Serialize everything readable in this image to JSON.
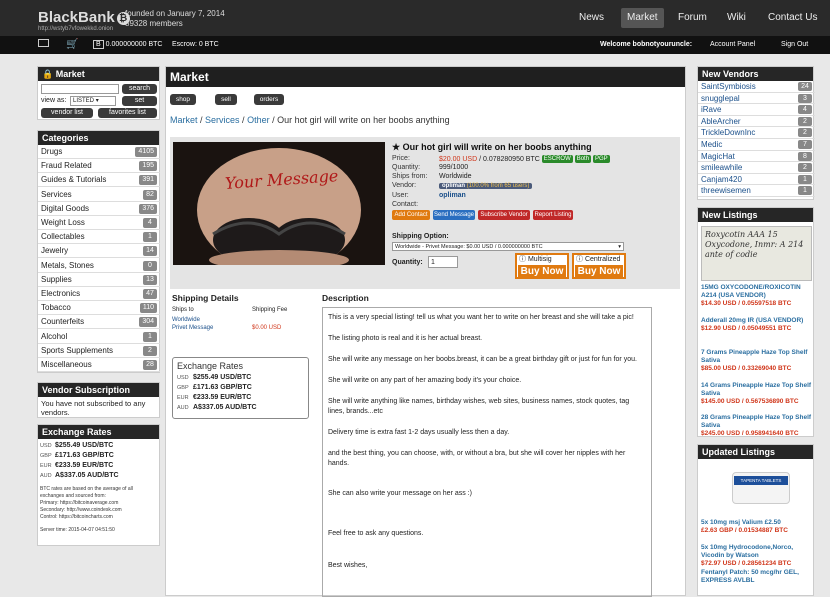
{
  "header": {
    "logo": "BlackBank",
    "logo_url": "http://wstyb7vfowekkd.onion",
    "founded": "founded on January 7, 2014",
    "members": "89328 members",
    "nav": [
      "News",
      "Market",
      "Forum",
      "Wiki",
      "Contact Us"
    ],
    "active_nav": "Market"
  },
  "subbar": {
    "balance": "0.000000000 BTC",
    "escrow": "Escrow: 0 BTC",
    "welcome": "Welcome bobnotyouruncle:",
    "account": "Account Panel",
    "signout": "Sign Out"
  },
  "market_box": {
    "title": "Market",
    "search_btn": "search",
    "view_as": "view as:",
    "view_value": "LISTED",
    "set_btn": "set",
    "vendor_list": "vendor list",
    "favorites": "favorites list"
  },
  "categories": {
    "title": "Categories",
    "items": [
      {
        "name": "Drugs",
        "count": "4105"
      },
      {
        "name": "Fraud Related",
        "count": "195"
      },
      {
        "name": "Guides & Tutorials",
        "count": "391"
      },
      {
        "name": "Services",
        "count": "82"
      },
      {
        "name": "Digital Goods",
        "count": "376"
      },
      {
        "name": "Weight Loss",
        "count": "4"
      },
      {
        "name": "Collectables",
        "count": "1"
      },
      {
        "name": "Jewelry",
        "count": "14"
      },
      {
        "name": "Metals, Stones",
        "count": "0"
      },
      {
        "name": "Supplies",
        "count": "13"
      },
      {
        "name": "Electronics",
        "count": "47"
      },
      {
        "name": "Tobacco",
        "count": "110"
      },
      {
        "name": "Counterfeits",
        "count": "304"
      },
      {
        "name": "Alcohol",
        "count": "1"
      },
      {
        "name": "Sports Supplements",
        "count": "2"
      },
      {
        "name": "Miscellaneous",
        "count": "28"
      }
    ]
  },
  "vendor_sub": {
    "title": "Vendor Subscription",
    "text": "You have not subscribed to any vendors."
  },
  "exchange_left": {
    "title": "Exchange Rates",
    "rates": [
      {
        "cur": "USD",
        "val": "$255.49 USD/BTC"
      },
      {
        "cur": "GBP",
        "val": "£171.63 GBP/BTC"
      },
      {
        "cur": "EUR",
        "val": "€233.59 EUR/BTC"
      },
      {
        "cur": "AUD",
        "val": "A$337.05 AUD/BTC"
      }
    ],
    "note": "BTC rates are based on the average of all exchanges and sourced from:",
    "primary": "Primary: https://bitcoinaverage.com",
    "secondary": "Secondary: http://www.coindesk.com",
    "control": "Control: https://bitcoincharts.com",
    "server_time": "Server time: 2015-04-07 04:51:50"
  },
  "main": {
    "title": "Market",
    "tabs": [
      "shop",
      "sell",
      "orders"
    ],
    "breadcrumb": [
      "Market",
      "Services",
      "Other"
    ],
    "breadcrumb_current": "Our hot girl will write on her boobs anything"
  },
  "listing": {
    "title": "Our hot girl will write on her boobs anything",
    "photo_text": "Your Message",
    "price_usd": "$20.00 USD",
    "price_btc": "/ 0.078280950 BTC",
    "quantity": "999/1000",
    "ships_from": "Worldwide",
    "vendor": "opliman",
    "vendor_stats": "(100.0% from 65 users)",
    "user": "opliman",
    "labels": {
      "price": "Price:",
      "quantity": "Quantity:",
      "ships_from": "Ships from:",
      "vendor": "Vendor:",
      "user": "User:",
      "contact": "Contact:"
    },
    "tags": [
      "ESCROW",
      "Both",
      "PGP"
    ],
    "actions": [
      "Add Contact",
      "Send Message",
      "Subscribe Vendor",
      "Report Listing"
    ],
    "shipping_label": "Shipping Option:",
    "shipping_value": "Worldwide - Privet Message: $0.00 USD / 0.000000000 BTC",
    "qty_label": "Quantity:",
    "qty_value": "1",
    "multisig": "Multisig",
    "centralized": "Centralized",
    "buy": "Buy Now",
    "colors": {
      "price": "#d0361a",
      "buy": "#e07a10"
    }
  },
  "shipping": {
    "title": "Shipping Details",
    "col1": "Ships to",
    "col2": "Shipping Fee",
    "dest": "Worldwide",
    "option": "Privet Message",
    "fee": "$0.00 USD"
  },
  "exchange_mid": {
    "title": "Exchange Rates",
    "rates": [
      {
        "cur": "USD",
        "val": "$255.49 USD/BTC"
      },
      {
        "cur": "GBP",
        "val": "£171.63 GBP/BTC"
      },
      {
        "cur": "EUR",
        "val": "€233.59 EUR/BTC"
      },
      {
        "cur": "AUD",
        "val": "A$337.05 AUD/BTC"
      }
    ]
  },
  "description": {
    "title": "Description",
    "paragraphs": [
      "This is a very special listing! tell us what you want her to write on her breast and she will take a pic!",
      "The listing photo is real and it is her actual breast.",
      "She will write any message on her boobs.breast, it can be a great birthday gift or just for fun for you.",
      "She will write on any part of her amazing body it's your choice.",
      "She will write anything like names, birthday wishes, web sites, business names, stock quotes, tag lines, brands...etc",
      "Delivery time is extra fast 1-2 days usually less then a day.",
      "and the best thing, you can choose, with, or without a bra, but she will cover her nipples with her hands.",
      "She can also write your message on her ass :)",
      "Feel free to ask any questions.",
      "Best wishes,"
    ]
  },
  "new_vendors": {
    "title": "New Vendors",
    "items": [
      {
        "name": "SaintSymbiosis",
        "count": "24"
      },
      {
        "name": "snugglepal",
        "count": "3"
      },
      {
        "name": "iRave",
        "count": "4"
      },
      {
        "name": "AbleArcher",
        "count": "2"
      },
      {
        "name": "TrickleDownInc",
        "count": "2"
      },
      {
        "name": "Medic",
        "count": "7"
      },
      {
        "name": "MagicHat",
        "count": "8"
      },
      {
        "name": "smileawhile",
        "count": "2"
      },
      {
        "name": "Canjam420",
        "count": "1"
      },
      {
        "name": "threewisemen",
        "count": "1"
      }
    ]
  },
  "new_listings": {
    "title": "New Listings",
    "thumb_text": "Roxycotin AAA 15 Oxycodone, Inmr: A 214 ante of codie",
    "items": [
      {
        "title": "15MG OXYCODONE/ROXICOTIN A214 (USA VENDOR)",
        "price": "$14.30 USD / 0.05597518 BTC"
      },
      {
        "title": "Adderall 20mg IR (USA VENDOR)",
        "price": "$12.90 USD / 0.05049551 BTC"
      },
      {
        "title": "7 Grams Pineapple Haze Top Shelf Sativa",
        "price": "$85.00 USD / 0.33269040 BTC"
      },
      {
        "title": "14 Grams Pineapple Haze Top Shelf Sativa",
        "price": "$145.00 USD / 0.567536890 BTC"
      },
      {
        "title": "28 Grams Pineapple Haze Top Shelf Sativa",
        "price": "$245.00 USD / 0.958941640 BTC"
      }
    ]
  },
  "updated_listings": {
    "title": "Updated Listings",
    "thumb_text": "TAPENTA TABLETS",
    "items": [
      {
        "title": "5x 10mg msj Valium £2.50",
        "price": "£2.63 GBP / 0.01534887 BTC"
      },
      {
        "title": "5x 10mg Hydrocodone,Norco, Vicodin by Watson",
        "price": "$72.97 USD / 0.28561234 BTC"
      },
      {
        "title": "Fentanyl Patch: 50 mcg/hr GEL, EXPRESS AVLBL",
        "price": ""
      }
    ]
  }
}
